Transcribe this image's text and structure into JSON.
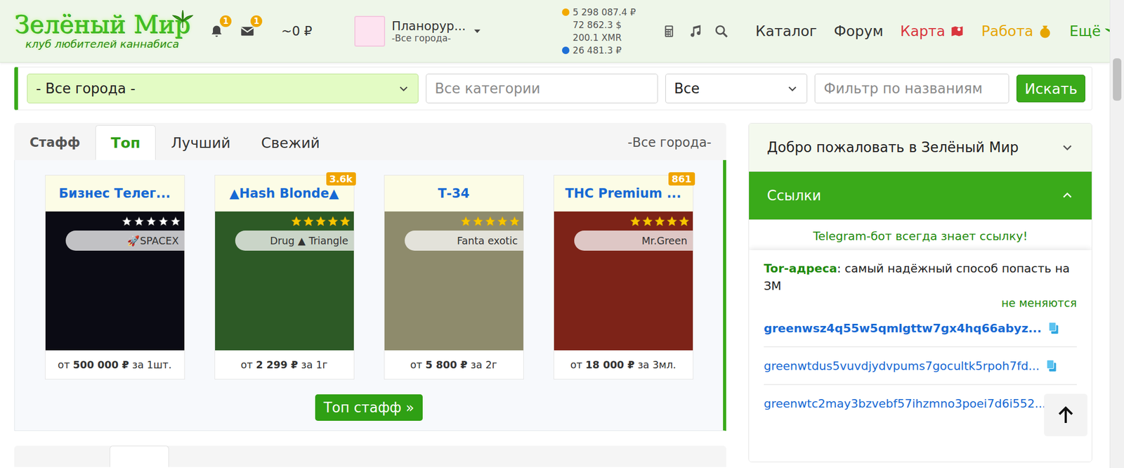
{
  "header": {
    "logo": {
      "title": "Зелёный Мир",
      "subtitle": "клуб любителей каннабиса"
    },
    "notifications": "1",
    "messages": "1",
    "money": "~0 ₽",
    "user": {
      "name": "Планорур...",
      "city": "-Все города-"
    },
    "balances": [
      {
        "value": "5 298 087.4 ₽",
        "color": "#f2a900"
      },
      {
        "value": "72 862.3 $",
        "color": ""
      },
      {
        "value": "200.1 XMR",
        "color": ""
      },
      {
        "value": "26 481.3 ₽",
        "color": "#1f6fd6"
      }
    ],
    "nav": [
      {
        "label": "Каталог",
        "color": "#333333"
      },
      {
        "label": "Форум",
        "color": "#333333"
      },
      {
        "label": "Карта",
        "color": "#d9363e"
      },
      {
        "label": "Работа",
        "color": "#e6a500"
      },
      {
        "label": "Ещё",
        "color": "#2f9e16"
      }
    ]
  },
  "filter": {
    "city": "- Все города -",
    "category_placeholder": "Все категории",
    "type": "Все",
    "name_placeholder": "Фильтр по названиям",
    "button": "Искать"
  },
  "tabs": [
    {
      "label": "Стафф",
      "selected": false
    },
    {
      "label": "Топ",
      "selected": true
    },
    {
      "label": "Лучший",
      "selected": false
    },
    {
      "label": "Свежий",
      "selected": false
    }
  ],
  "tabs_city": "-Все города-",
  "cards": [
    {
      "title": "Бизнес Телег...",
      "badge": "",
      "stars": 0,
      "shop": "🚀SPACEX",
      "price_prefix": "от ",
      "price": "500 000 ₽",
      "price_suffix": " за 1шт."
    },
    {
      "title": "▲Hash Blonde▲",
      "badge": "3.6k",
      "stars": 5,
      "shop": "Drug ▲ Triangle",
      "price_prefix": "от ",
      "price": "2 299 ₽",
      "price_suffix": " за 1г"
    },
    {
      "title": "Т-34",
      "badge": "",
      "stars": 5,
      "shop": "Fanta exotic",
      "price_prefix": "от ",
      "price": "5 800 ₽",
      "price_suffix": " за 2г"
    },
    {
      "title": "THC Premium ...",
      "badge": "861",
      "stars": 5,
      "shop": "Mr.Green",
      "price_prefix": "от ",
      "price": "18 000 ₽",
      "price_suffix": " за 3мл."
    }
  ],
  "top_button": "Топ стафф »",
  "sidebar": {
    "sections": [
      {
        "label": "Добро пожаловать в Зелёный Мир",
        "expanded": false
      },
      {
        "label": "Ссылки",
        "expanded": true
      }
    ],
    "telegram": "Telegram-бот всегда знает ссылку!",
    "tor_title": "Tor-адреса",
    "tor_text": ": самый надёжный способ попасть на ЗМ",
    "tor_note": "не меняются",
    "links": [
      {
        "text": "greenwsz4q55w5qmlgttw7gx4hq66abyz...",
        "primary": true
      },
      {
        "text": "greenwtdus5vuvdjydvpums7gocultk5rpoh7fd...",
        "primary": false
      },
      {
        "text": "greenwtc2may3bzvebf57ihzmno3poei7d6i552...",
        "primary": false
      }
    ]
  }
}
